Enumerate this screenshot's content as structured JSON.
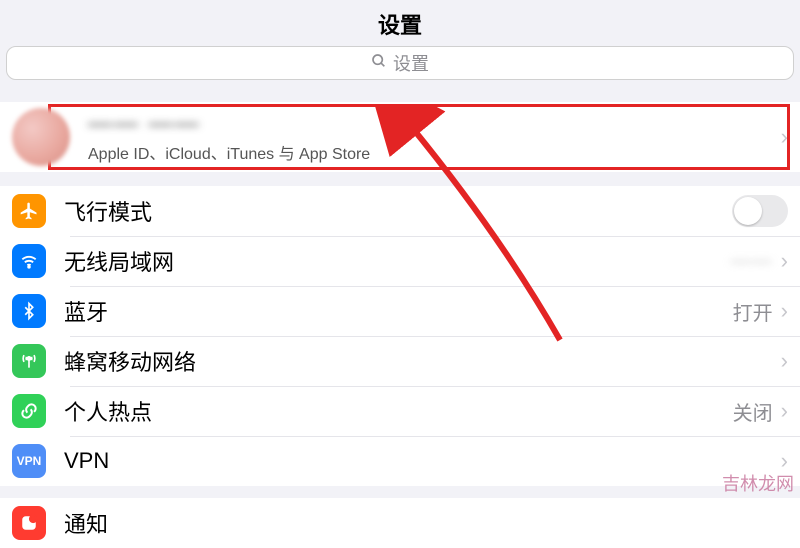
{
  "header": {
    "title": "设置"
  },
  "search": {
    "placeholder": "设置"
  },
  "account": {
    "name": "—— ——",
    "subtitle": "Apple ID、iCloud、iTunes 与 App Store"
  },
  "rows": {
    "airplane": {
      "label": "飞行模式",
      "icon": "airplane-icon"
    },
    "wifi": {
      "label": "无线局域网",
      "value": "——",
      "icon": "wifi-icon"
    },
    "bluetooth": {
      "label": "蓝牙",
      "value": "打开",
      "icon": "bluetooth-icon"
    },
    "cellular": {
      "label": "蜂窝移动网络",
      "icon": "antenna-icon"
    },
    "hotspot": {
      "label": "个人热点",
      "value": "关闭",
      "icon": "link-icon"
    },
    "vpn": {
      "label": "VPN",
      "icon": "vpn-icon",
      "badge": "VPN"
    },
    "notify": {
      "label": "通知",
      "icon": "notification-icon"
    }
  },
  "annotation": {
    "highlight_color": "#e32424",
    "arrow_color": "#e32424"
  },
  "watermark": "吉林龙网"
}
